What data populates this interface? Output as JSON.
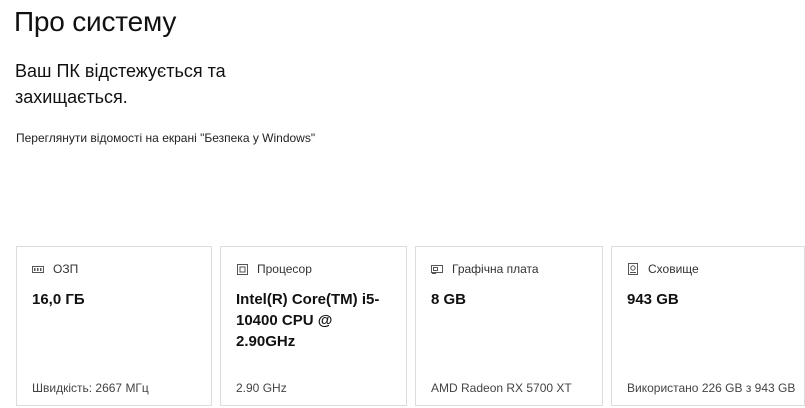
{
  "page": {
    "title": "Про систему"
  },
  "security": {
    "status_text": "Ваш ПК відстежується та захищається.",
    "link_text": "Переглянути відомості на екрані \"Безпека у Windows\""
  },
  "cards": {
    "ram": {
      "icon": "ram-icon",
      "label": "ОЗП",
      "value": "16,0 ГБ",
      "detail": "Швидкість: 2667 МГц"
    },
    "cpu": {
      "icon": "processor-icon",
      "label": "Процесор",
      "value": "Intel(R) Core(TM) i5-10400 CPU @ 2.90GHz",
      "detail": "2.90 GHz"
    },
    "gpu": {
      "icon": "graphics-card-icon",
      "label": "Графічна плата",
      "value": "8 GB",
      "detail": "AMD Radeon RX 5700 XT"
    },
    "storage": {
      "icon": "storage-icon",
      "label": "Сховище",
      "value": "943 GB",
      "detail": "Використано 226 GB з 943 GB"
    }
  }
}
